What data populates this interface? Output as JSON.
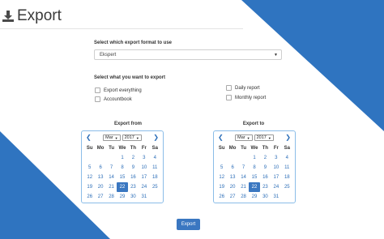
{
  "page": {
    "title": "Export"
  },
  "format": {
    "label": "Select which export format to use",
    "selected": "Ekspert"
  },
  "export_what": {
    "label": "Select what you want to export",
    "options": [
      "Export everything",
      "Accountbook",
      "Daily report",
      "Monthly report"
    ]
  },
  "from": {
    "title": "Export from",
    "month": "Mar",
    "year": "2017",
    "weekdays": [
      "Su",
      "Mo",
      "Tu",
      "We",
      "Th",
      "Fr",
      "Sa"
    ],
    "days": [
      "",
      "",
      "",
      "1",
      "2",
      "3",
      "4",
      "5",
      "6",
      "7",
      "8",
      "9",
      "10",
      "11",
      "12",
      "13",
      "14",
      "15",
      "16",
      "17",
      "18",
      "19",
      "20",
      "21",
      "22",
      "23",
      "24",
      "25",
      "26",
      "27",
      "28",
      "29",
      "30",
      "31",
      ""
    ],
    "selected_day": "22"
  },
  "to": {
    "title": "Export to",
    "month": "Mar",
    "year": "2017",
    "weekdays": [
      "Su",
      "Mo",
      "Tu",
      "We",
      "Th",
      "Fr",
      "Sa"
    ],
    "days": [
      "",
      "",
      "",
      "1",
      "2",
      "3",
      "4",
      "5",
      "6",
      "7",
      "8",
      "9",
      "10",
      "11",
      "12",
      "13",
      "14",
      "15",
      "16",
      "17",
      "18",
      "19",
      "20",
      "21",
      "22",
      "23",
      "24",
      "25",
      "26",
      "27",
      "28",
      "29",
      "30",
      "31",
      ""
    ],
    "selected_day": "22"
  },
  "actions": {
    "export_label": "Export"
  },
  "colors": {
    "accent": "#3a77c1",
    "shape": "#2f74c0"
  }
}
